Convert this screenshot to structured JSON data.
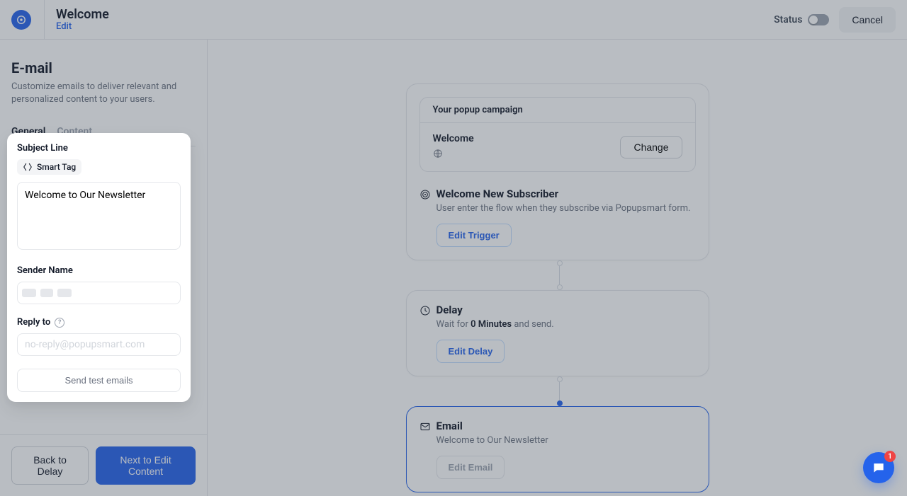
{
  "header": {
    "title": "Welcome",
    "edit": "Edit",
    "status_label": "Status",
    "cancel": "Cancel"
  },
  "sidebar": {
    "title": "E-mail",
    "desc": "Customize emails to deliver relevant and personalized content to your users.",
    "tabs": {
      "general": "General",
      "content": "Content"
    },
    "footer": {
      "back": "Back to Delay",
      "next": "Next to Edit Content"
    }
  },
  "form": {
    "subject_label": "Subject Line",
    "smart_tag": "Smart Tag",
    "subject_value": "Welcome to Our Newsletter",
    "sender_label": "Sender Name",
    "reply_label": "Reply to",
    "reply_placeholder": "no-reply@popupsmart.com",
    "send_test": "Send test emails"
  },
  "flow": {
    "popup_header": "Your popup campaign",
    "popup_name": "Welcome",
    "change": "Change",
    "trigger_title": "Welcome New Subscriber",
    "trigger_desc": "User enter the flow when they subscribe via Popupsmart form.",
    "edit_trigger": "Edit Trigger",
    "delay_title": "Delay",
    "delay_prefix": "Wait for ",
    "delay_value": "0 Minutes",
    "delay_suffix": " and send.",
    "edit_delay": "Edit Delay",
    "email_title": "Email",
    "email_subject": "Welcome to Our Newsletter",
    "edit_email": "Edit Email"
  },
  "chat": {
    "badge": "1"
  }
}
